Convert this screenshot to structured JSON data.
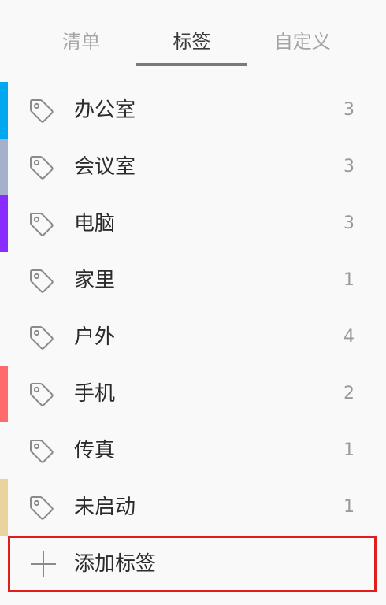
{
  "tabs": [
    {
      "label": "清单",
      "active": false
    },
    {
      "label": "标签",
      "active": true
    },
    {
      "label": "自定义",
      "active": false
    }
  ],
  "tags": [
    {
      "name": "办公室",
      "count": "3",
      "color": "#00a8f0"
    },
    {
      "name": "会议室",
      "count": "3",
      "color": "#a4b0cc"
    },
    {
      "name": "电脑",
      "count": "3",
      "color": "#8a2bff"
    },
    {
      "name": "家里",
      "count": "1",
      "color": ""
    },
    {
      "name": "户外",
      "count": "4",
      "color": ""
    },
    {
      "name": "手机",
      "count": "2",
      "color": "#ff6a6a"
    },
    {
      "name": "传真",
      "count": "1",
      "color": ""
    },
    {
      "name": "未启动",
      "count": "1",
      "color": "#e8d49c"
    }
  ],
  "add_tag": {
    "label": "添加标签",
    "icon": "plus-icon"
  },
  "icons": {
    "tag": "tag-icon"
  },
  "colors": {
    "highlight_border": "#e01e1e",
    "active_tab_underline": "#7a7a7a"
  }
}
